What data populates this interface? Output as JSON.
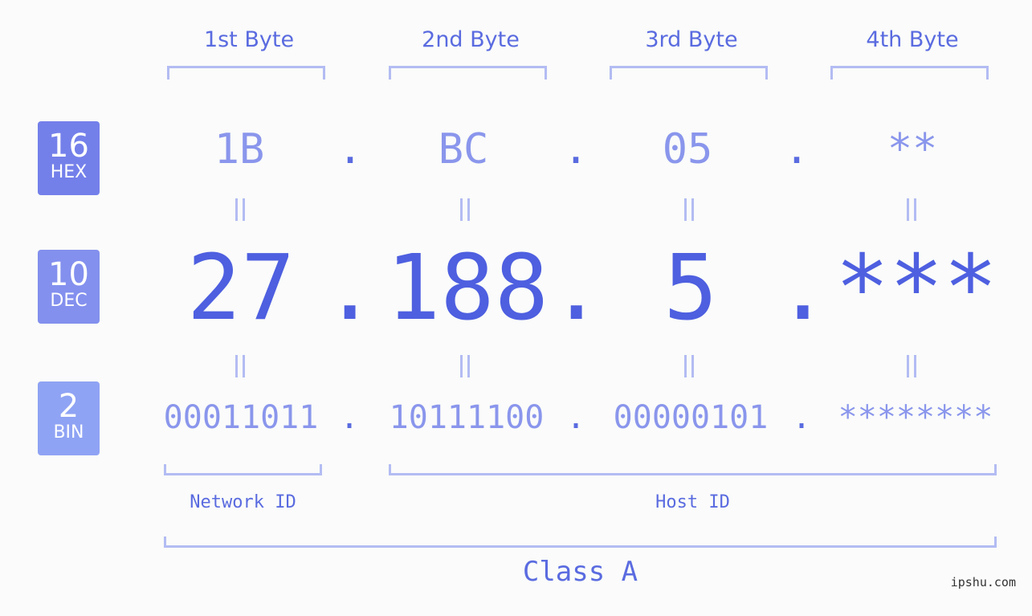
{
  "colors": {
    "accent": "#5a6be0",
    "dec_value": "#4e5fe0",
    "light_value": "#8a96ec",
    "bracket": "#b3bcf3",
    "hex_badge": "#7480ea",
    "dec_badge": "#8390ee",
    "bin_badge": "#8fa3f4",
    "background": "#fafbfa"
  },
  "byte_headers": [
    "1st Byte",
    "2nd Byte",
    "3rd Byte",
    "4th Byte"
  ],
  "badges": {
    "hex": {
      "number": "16",
      "label": "HEX"
    },
    "dec": {
      "number": "10",
      "label": "DEC"
    },
    "bin": {
      "number": "2",
      "label": "BIN"
    }
  },
  "separator": ".",
  "hex_values": [
    "1B",
    "BC",
    "05",
    "**"
  ],
  "dec_values": [
    "27",
    "188",
    "5",
    "***"
  ],
  "bin_values": [
    "00011011",
    "10111100",
    "00000101",
    "********"
  ],
  "network_id_label": "Network ID",
  "host_id_label": "Host ID",
  "class_label": "Class A",
  "watermark": "ipshu.com"
}
